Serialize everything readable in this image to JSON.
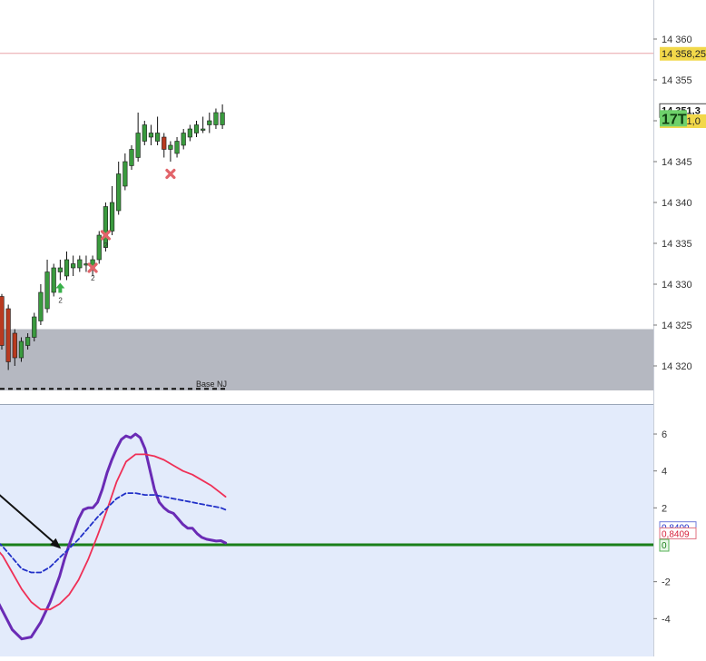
{
  "colors": {
    "price_bg": "#ffffff",
    "osc_bg": "#e3ebfb",
    "zone_fill": "#b5b8c1",
    "bull_candle": "#3a9a3e",
    "bear_candle": "#b83a20",
    "sell_marker": "#e2646a",
    "buy_marker": "#38b049",
    "resistance_line": "#e9a3a8",
    "purple_line": "#6a2bb5",
    "red_line": "#ef2f56",
    "blue_dashed_line": "#2130c8",
    "zero_line": "#1a7f1a",
    "arrow": "#111111"
  },
  "chart_data": [
    {
      "type": "candlestick",
      "ylim": [
        14316,
        14364
      ],
      "y_ticks": [
        {
          "label": "14 360",
          "value": 14360
        },
        {
          "label": "14 355",
          "value": 14355
        },
        {
          "label": "14 350",
          "value": 14350
        },
        {
          "label": "14 345",
          "value": 14345
        },
        {
          "label": "14 340",
          "value": 14340
        },
        {
          "label": "14 335",
          "value": 14335
        },
        {
          "label": "14 330",
          "value": 14330
        },
        {
          "label": "14 325",
          "value": 14325
        },
        {
          "label": "14 320",
          "value": 14320
        }
      ],
      "price_badges": [
        {
          "label": "14 358,25",
          "value": 14358.25,
          "style": "yellow"
        },
        {
          "label": "14 351,3",
          "value": 14351.3,
          "style": "white"
        },
        {
          "label": "14 351,0",
          "value": 14350.0,
          "style": "yellow"
        },
        {
          "label": "17T",
          "value": 14350.3,
          "style": "green"
        }
      ],
      "resistance_level": 14358.25,
      "zone": {
        "from": 14317,
        "to": 14324.5
      },
      "zone_label": "Base NJ",
      "support_dashed_level": 14317.2,
      "candles": [
        {
          "o": 14328.5,
          "h": 14328.8,
          "l": 14322.0,
          "c": 14322.5
        },
        {
          "o": 14327.0,
          "h": 14327.5,
          "l": 14319.5,
          "c": 14320.5
        },
        {
          "o": 14324.0,
          "h": 14324.5,
          "l": 14320.0,
          "c": 14321.0
        },
        {
          "o": 14321.0,
          "h": 14323.5,
          "l": 14320.5,
          "c": 14323.0
        },
        {
          "o": 14322.5,
          "h": 14324.0,
          "l": 14322.0,
          "c": 14323.5
        },
        {
          "o": 14323.5,
          "h": 14326.5,
          "l": 14323.0,
          "c": 14326.0
        },
        {
          "o": 14325.5,
          "h": 14330.0,
          "l": 14325.0,
          "c": 14329.0
        },
        {
          "o": 14327.0,
          "h": 14333.0,
          "l": 14326.5,
          "c": 14331.5
        },
        {
          "o": 14329.0,
          "h": 14332.5,
          "l": 14328.5,
          "c": 14332.0
        },
        {
          "o": 14331.5,
          "h": 14333.0,
          "l": 14330.5,
          "c": 14332.0
        },
        {
          "o": 14331.0,
          "h": 14334.0,
          "l": 14330.5,
          "c": 14333.0
        },
        {
          "o": 14332.0,
          "h": 14333.5,
          "l": 14331.0,
          "c": 14332.5
        },
        {
          "o": 14332.0,
          "h": 14333.5,
          "l": 14331.5,
          "c": 14333.0
        },
        {
          "o": 14332.5,
          "h": 14333.5,
          "l": 14331.5,
          "c": 14332.5
        },
        {
          "o": 14332.0,
          "h": 14333.5,
          "l": 14331.0,
          "c": 14333.0
        },
        {
          "o": 14333.0,
          "h": 14336.5,
          "l": 14332.5,
          "c": 14336.0
        },
        {
          "o": 14334.5,
          "h": 14340.0,
          "l": 14334.0,
          "c": 14339.5
        },
        {
          "o": 14336.5,
          "h": 14342.0,
          "l": 14336.0,
          "c": 14340.0
        },
        {
          "o": 14339.0,
          "h": 14345.0,
          "l": 14338.5,
          "c": 14343.5
        },
        {
          "o": 14342.0,
          "h": 14346.0,
          "l": 14341.5,
          "c": 14345.0
        },
        {
          "o": 14344.5,
          "h": 14347.0,
          "l": 14344.0,
          "c": 14346.5
        },
        {
          "o": 14345.5,
          "h": 14351.0,
          "l": 14345.0,
          "c": 14348.5
        },
        {
          "o": 14347.5,
          "h": 14350.0,
          "l": 14347.0,
          "c": 14349.5
        },
        {
          "o": 14348.0,
          "h": 14349.5,
          "l": 14347.0,
          "c": 14348.5
        },
        {
          "o": 14347.5,
          "h": 14350.5,
          "l": 14347.0,
          "c": 14348.5
        },
        {
          "o": 14348.0,
          "h": 14348.5,
          "l": 14345.5,
          "c": 14346.5
        },
        {
          "o": 14346.5,
          "h": 14347.5,
          "l": 14345.0,
          "c": 14347.0
        },
        {
          "o": 14346.0,
          "h": 14348.0,
          "l": 14345.5,
          "c": 14347.5
        },
        {
          "o": 14347.0,
          "h": 14349.0,
          "l": 14346.5,
          "c": 14348.5
        },
        {
          "o": 14348.0,
          "h": 14349.5,
          "l": 14347.5,
          "c": 14349.0
        },
        {
          "o": 14348.5,
          "h": 14350.0,
          "l": 14348.0,
          "c": 14349.5
        },
        {
          "o": 14349.0,
          "h": 14350.5,
          "l": 14348.5,
          "c": 14349.0
        },
        {
          "o": 14349.5,
          "h": 14351.0,
          "l": 14348.5,
          "c": 14350.0
        },
        {
          "o": 14349.5,
          "h": 14351.5,
          "l": 14349.0,
          "c": 14351.0
        },
        {
          "o": 14349.5,
          "h": 14352.0,
          "l": 14349.0,
          "c": 14351.0
        }
      ],
      "markers": [
        {
          "type": "sell",
          "candle": 14,
          "price": 14332.0,
          "label": "2"
        },
        {
          "type": "sell",
          "candle": 16,
          "price": 14336.0,
          "label": "2"
        },
        {
          "type": "sell",
          "candle": 26,
          "price": 14343.5,
          "label": ""
        },
        {
          "type": "buy",
          "candle": 9,
          "price": 14329.5,
          "label": "2"
        }
      ]
    },
    {
      "type": "line",
      "ylim": [
        -5.3,
        7.5
      ],
      "y_ticks": [
        {
          "label": "6",
          "value": 6
        },
        {
          "label": "4",
          "value": 4
        },
        {
          "label": "2",
          "value": 2
        },
        {
          "label": "-2",
          "value": -2
        },
        {
          "label": "-4",
          "value": -4
        }
      ],
      "value_badges": [
        {
          "label": "0,8409",
          "value": 0.95,
          "color": "blue"
        },
        {
          "label": "0,8409",
          "value": 0.62,
          "color": "red"
        },
        {
          "label": "0",
          "value": 0.0,
          "color": "green"
        }
      ],
      "zero_level": 0,
      "series": [
        {
          "key": "purple",
          "x": [
            -4,
            0,
            4,
            8,
            12,
            16,
            20,
            24,
            26,
            28,
            30,
            32,
            34,
            36,
            38,
            40,
            42,
            44,
            46,
            48,
            50,
            52,
            54,
            56,
            58,
            60,
            62,
            64,
            66,
            68,
            70,
            72,
            74,
            76,
            78,
            80,
            82,
            84,
            86,
            88,
            90,
            92,
            94
          ],
          "y": [
            -2.6,
            -3.6,
            -4.6,
            -5.1,
            -5.0,
            -4.2,
            -3.1,
            -1.7,
            -0.8,
            0.0,
            0.7,
            1.4,
            1.9,
            2.0,
            2.0,
            2.3,
            3.0,
            3.9,
            4.6,
            5.2,
            5.7,
            5.9,
            5.8,
            6.0,
            5.8,
            5.2,
            4.1,
            3.0,
            2.3,
            2.0,
            1.8,
            1.7,
            1.4,
            1.1,
            0.9,
            0.9,
            0.6,
            0.4,
            0.3,
            0.25,
            0.2,
            0.22,
            0.1
          ]
        },
        {
          "key": "red",
          "x": [
            -4,
            0,
            4,
            8,
            12,
            16,
            20,
            24,
            28,
            32,
            36,
            40,
            44,
            48,
            52,
            56,
            60,
            64,
            68,
            72,
            76,
            80,
            84,
            88,
            92,
            94
          ],
          "y": [
            0.0,
            -0.6,
            -1.5,
            -2.4,
            -3.1,
            -3.5,
            -3.5,
            -3.2,
            -2.7,
            -1.9,
            -0.8,
            0.5,
            1.9,
            3.4,
            4.5,
            4.9,
            4.9,
            4.8,
            4.6,
            4.3,
            4.0,
            3.8,
            3.5,
            3.2,
            2.8,
            2.6
          ]
        },
        {
          "key": "blue",
          "x": [
            -4,
            0,
            4,
            8,
            12,
            16,
            20,
            24,
            28,
            32,
            36,
            40,
            44,
            48,
            52,
            56,
            60,
            64,
            68,
            72,
            76,
            80,
            84,
            88,
            92,
            94
          ],
          "y": [
            0.4,
            -0.1,
            -0.7,
            -1.3,
            -1.5,
            -1.5,
            -1.2,
            -0.7,
            -0.2,
            0.3,
            0.9,
            1.5,
            2.0,
            2.5,
            2.8,
            2.8,
            2.7,
            2.7,
            2.6,
            2.5,
            2.4,
            2.3,
            2.2,
            2.1,
            2.0,
            1.9
          ]
        }
      ],
      "annotation_arrow": {
        "from": [
          -4,
          3.0
        ],
        "to": [
          24,
          -0.15
        ]
      }
    }
  ]
}
